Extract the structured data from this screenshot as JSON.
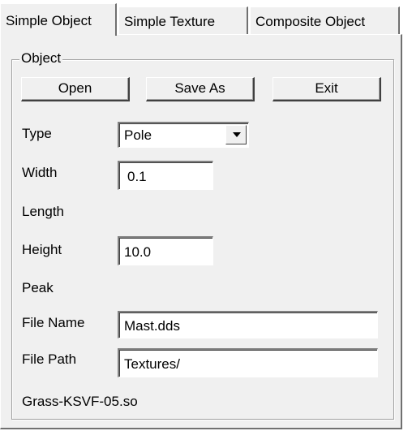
{
  "tabs": [
    {
      "label": "Simple Object",
      "active": true
    },
    {
      "label": "Simple Texture",
      "active": false
    },
    {
      "label": "Composite Object",
      "active": false
    }
  ],
  "group": {
    "title": "Object"
  },
  "buttons": {
    "open": "Open",
    "save_as": "Save As",
    "exit": "Exit"
  },
  "fields": {
    "type": {
      "label": "Type",
      "value": "Pole"
    },
    "width": {
      "label": "Width",
      "value": "0.1"
    },
    "length": {
      "label": "Length"
    },
    "height": {
      "label": "Height",
      "value": "10.0"
    },
    "peak": {
      "label": "Peak"
    },
    "file_name": {
      "label": "File Name",
      "value": "Mast.dds"
    },
    "file_path": {
      "label": "File Path",
      "value": "Textures/"
    }
  },
  "footer": {
    "filename": "Grass-KSVF-05.so"
  },
  "icons": {
    "dropdown": "chevron-down-icon"
  }
}
